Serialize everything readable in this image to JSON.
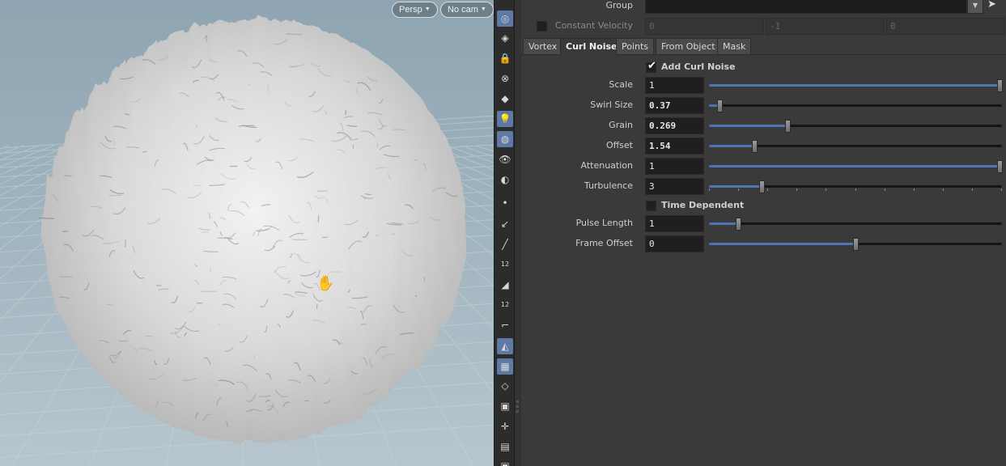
{
  "viewport": {
    "persp_label": "Persp",
    "cam_label": "No cam"
  },
  "shelf": {
    "tools": [
      {
        "icon": "view-icon",
        "glyph": "◎",
        "on": true
      },
      {
        "icon": "wireframe-icon",
        "glyph": "◈",
        "on": false
      },
      {
        "icon": "lock-icon",
        "glyph": "🔒",
        "on": false
      },
      {
        "icon": "ghost-icon",
        "glyph": "⊗",
        "on": false
      },
      {
        "icon": "snap-icon",
        "glyph": "◆",
        "on": false
      },
      {
        "icon": "light-icon",
        "glyph": "💡",
        "on": true
      },
      {
        "icon": "shading-icon",
        "glyph": "◍",
        "on": true
      },
      {
        "icon": "eye-icon",
        "glyph": "👁",
        "on": false
      },
      {
        "icon": "camera-icon",
        "glyph": "◐",
        "on": false
      },
      {
        "icon": "point-icon",
        "glyph": "•",
        "on": false
      },
      {
        "icon": "normal-icon",
        "glyph": "↙",
        "on": false
      },
      {
        "icon": "brush-icon",
        "glyph": "╱",
        "on": false
      },
      {
        "icon": "point-number-icon",
        "glyph": "12",
        "on": false
      },
      {
        "icon": "prim-icon",
        "glyph": "◢",
        "on": false
      },
      {
        "icon": "prim-number-icon",
        "glyph": "12",
        "on": false
      },
      {
        "icon": "edge-icon",
        "glyph": "⌐",
        "on": false
      },
      {
        "icon": "backface-icon",
        "glyph": "◭",
        "on": true
      },
      {
        "icon": "texture-icon",
        "glyph": "▦",
        "on": true
      },
      {
        "icon": "shape-icon",
        "glyph": "◇",
        "on": false
      },
      {
        "icon": "render-icon",
        "glyph": "▣",
        "on": false
      },
      {
        "icon": "handle-icon",
        "glyph": "✛",
        "on": false
      },
      {
        "icon": "display-icon",
        "glyph": "▤",
        "on": false
      },
      {
        "icon": "extra-icon",
        "glyph": "▣",
        "on": false
      }
    ]
  },
  "params": {
    "group": {
      "label": "Group",
      "value": ""
    },
    "constant_velocity": {
      "label": "Constant Velocity",
      "x": "0",
      "y": "-1",
      "z": "0"
    },
    "tabs": [
      {
        "label": "Vortex",
        "active": false
      },
      {
        "label": "Curl Noise",
        "active": true
      },
      {
        "label": "Points",
        "active": false
      },
      {
        "label": "From Object",
        "active": false
      },
      {
        "label": "Mask",
        "active": false
      }
    ],
    "add_curl_noise": {
      "label": "Add Curl Noise",
      "checked": true
    },
    "rows": [
      {
        "label": "Scale",
        "value": "1",
        "bold": false,
        "fraction": 1.0
      },
      {
        "label": "Swirl Size",
        "value": "0.37",
        "bold": true,
        "fraction": 0.037
      },
      {
        "label": "Grain",
        "value": "0.269",
        "bold": true,
        "fraction": 0.269
      },
      {
        "label": "Offset",
        "value": "1.54",
        "bold": true,
        "fraction": 0.154
      },
      {
        "label": "Attenuation",
        "value": "1",
        "bold": false,
        "fraction": 1.0
      },
      {
        "label": "Turbulence",
        "value": "3",
        "bold": false,
        "fraction": 0.18
      }
    ],
    "time_dependent": {
      "label": "Time Dependent",
      "checked": false
    },
    "rows2": [
      {
        "label": "Pulse Length",
        "value": "1",
        "bold": false,
        "fraction": 0.1
      },
      {
        "label": "Frame Offset",
        "value": "0",
        "bold": false,
        "fraction": 0.5
      }
    ]
  },
  "colors": {
    "accent": "#4f74b4",
    "panel": "#3a3a3a",
    "field": "#1f1f1f"
  }
}
